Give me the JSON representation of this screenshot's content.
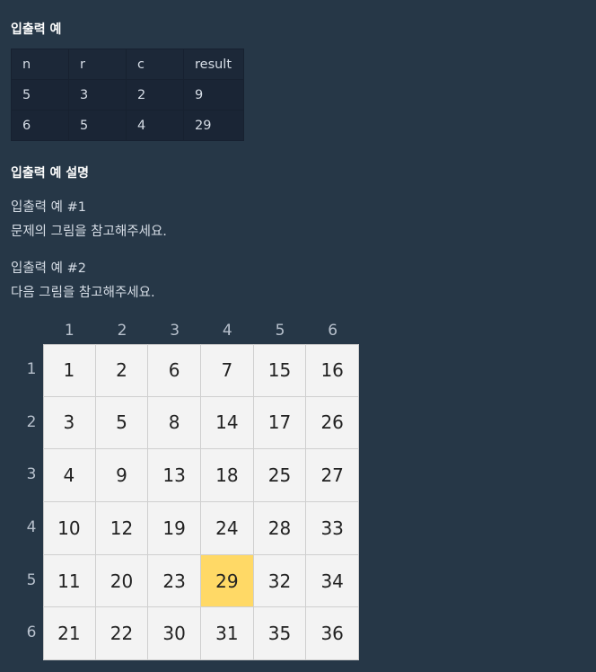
{
  "section1": {
    "title": "입출력 예"
  },
  "io_table": {
    "headers": [
      "n",
      "r",
      "c",
      "result"
    ],
    "rows": [
      [
        "5",
        "3",
        "2",
        "9"
      ],
      [
        "6",
        "5",
        "4",
        "29"
      ]
    ]
  },
  "section2": {
    "title": "입출력 예 설명",
    "ex1_title": "입출력 예 #1",
    "ex1_text": "문제의 그림을 참고해주세요.",
    "ex2_title": "입출력 예 #2",
    "ex2_text": "다음 그림을 참고해주세요."
  },
  "figure": {
    "col_labels": [
      "1",
      "2",
      "3",
      "4",
      "5",
      "6"
    ],
    "row_labels": [
      "1",
      "2",
      "3",
      "4",
      "5",
      "6"
    ],
    "cells": [
      [
        "1",
        "2",
        "6",
        "7",
        "15",
        "16"
      ],
      [
        "3",
        "5",
        "8",
        "14",
        "17",
        "26"
      ],
      [
        "4",
        "9",
        "13",
        "18",
        "25",
        "27"
      ],
      [
        "10",
        "12",
        "19",
        "24",
        "28",
        "33"
      ],
      [
        "11",
        "20",
        "23",
        "29",
        "32",
        "34"
      ],
      [
        "21",
        "22",
        "30",
        "31",
        "35",
        "36"
      ]
    ],
    "highlight": {
      "row": 5,
      "col": 4,
      "color": "#ffd966"
    }
  }
}
